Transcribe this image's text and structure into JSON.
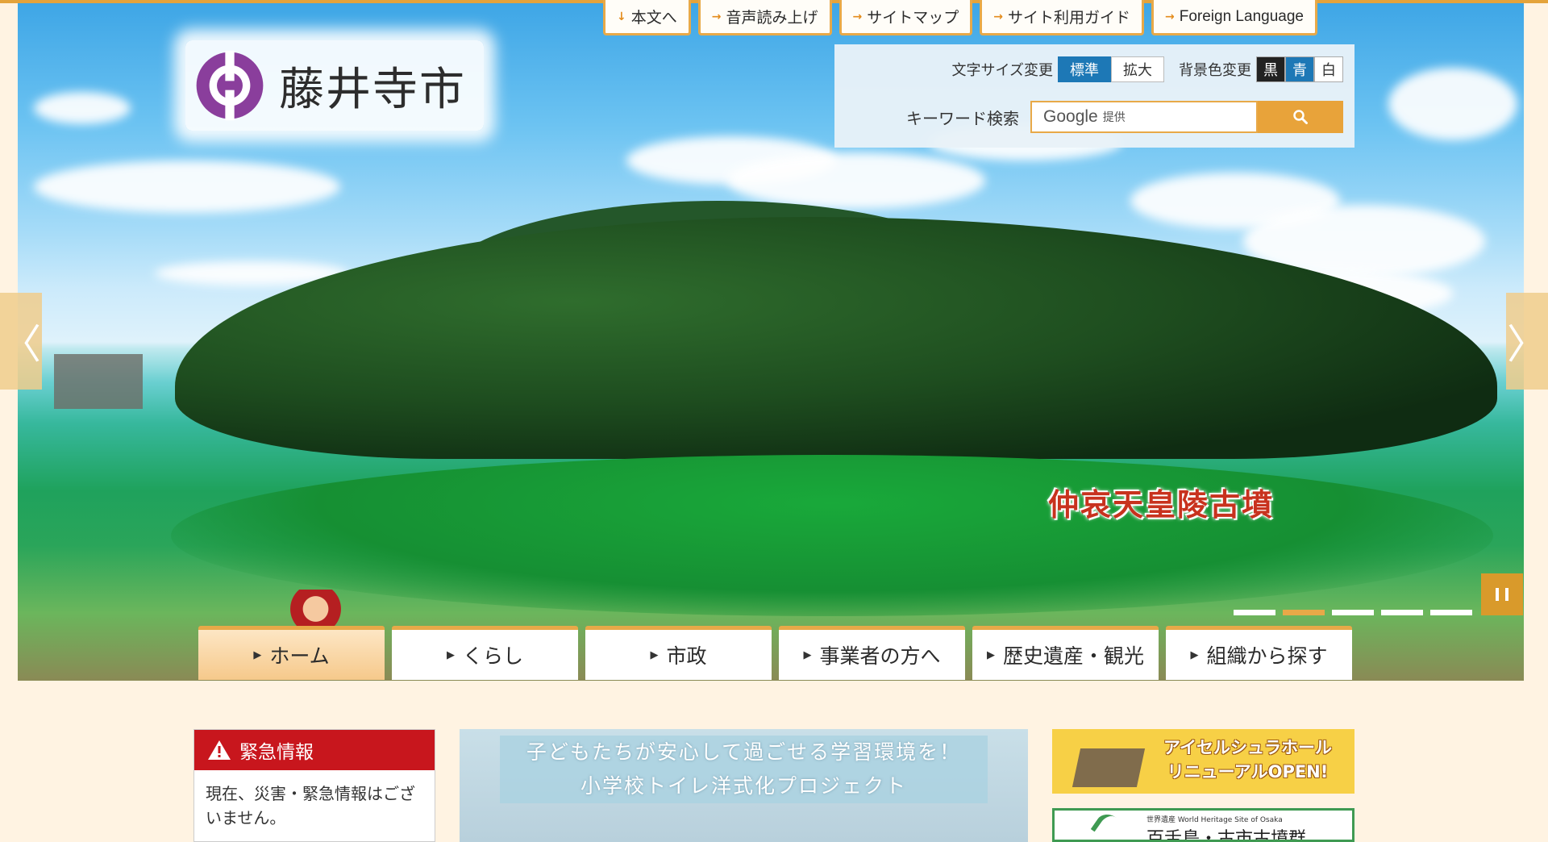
{
  "site": {
    "logo_text": "藤井寺市"
  },
  "top_links": [
    {
      "label": "本文へ",
      "arrow": "↓"
    },
    {
      "label": "音声読み上げ",
      "arrow": "→"
    },
    {
      "label": "サイトマップ",
      "arrow": "→"
    },
    {
      "label": "サイト利用ガイド",
      "arrow": "→"
    },
    {
      "label": "Foreign Language",
      "arrow": "→"
    }
  ],
  "tools": {
    "font_size_label": "文字サイズ変更",
    "font_size_standard": "標準",
    "font_size_large": "拡大",
    "bg_color_label": "背景色変更",
    "bg_black": "黒",
    "bg_blue": "青",
    "bg_white": "白",
    "keyword_label": "キーワード検索",
    "search_brand": "Google",
    "search_provided": "提供"
  },
  "slideshow": {
    "caption": "仲哀天皇陵古墳",
    "prev_icon": "〈",
    "next_icon": "〉",
    "slide_count": 5,
    "active_slide": 2
  },
  "main_nav": [
    {
      "label": "ホーム",
      "active": true
    },
    {
      "label": "くらし",
      "active": false
    },
    {
      "label": "市政",
      "active": false
    },
    {
      "label": "事業者の方へ",
      "active": false
    },
    {
      "label": "歴史遺産・観光",
      "active": false
    },
    {
      "label": "組織から探す",
      "active": false
    }
  ],
  "emergency": {
    "title": "緊急情報",
    "body": "現在、災害・緊急情報はございません。"
  },
  "banners": {
    "main_line1": "子どもたちが安心して過ごせる学習環境を！",
    "main_line2": "小学校トイレ洋式化プロジェクト",
    "side_a_line1": "アイセルシュラホール",
    "side_a_line2": "リニューアルOPEN!",
    "side_b_small": "世界遺産 World Heritage Site of Osaka",
    "side_b_big": "百舌鳥・古市古墳群"
  },
  "colors": {
    "accent": "#e8a948",
    "nav_active": "#f6c98b",
    "emergency": "#c8161d",
    "selected_blue": "#1d78b6",
    "page_bg": "#fff3e2"
  }
}
